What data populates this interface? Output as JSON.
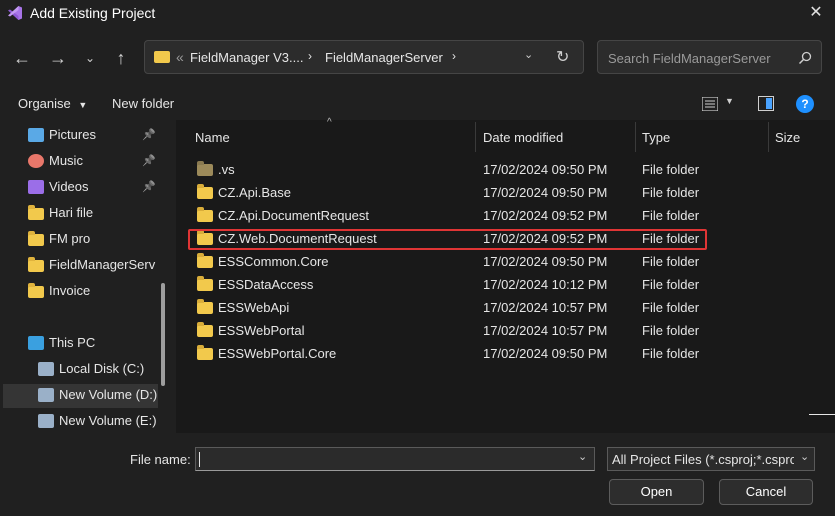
{
  "window": {
    "title": "Add Existing Project",
    "app_icon": "visual-studio-icon",
    "close_icon": "close-icon"
  },
  "nav": {
    "back_icon": "arrow-left-icon",
    "forward_icon": "arrow-right-icon",
    "recent_icon": "chevron-down-icon",
    "up_icon": "arrow-up-icon",
    "breadcrumb": [
      "FieldManager V3....",
      "FieldManagerServer"
    ],
    "breadcrumb_prefix": "«",
    "refresh_icon": "refresh-icon",
    "search_placeholder": "Search FieldManagerServer"
  },
  "toolbar": {
    "organise": "Organise",
    "new_folder": "New folder",
    "view_icon": "view-list-icon",
    "preview_icon": "preview-pane-icon",
    "help_icon": "help-icon"
  },
  "sidebar": {
    "items": [
      {
        "label": "Pictures",
        "icon": "pictures-icon",
        "pinned": true
      },
      {
        "label": "Music",
        "icon": "music-icon",
        "pinned": true
      },
      {
        "label": "Videos",
        "icon": "videos-icon",
        "pinned": true
      },
      {
        "label": "Hari file",
        "icon": "folder-icon",
        "pinned": false
      },
      {
        "label": "FM pro",
        "icon": "folder-icon",
        "pinned": false
      },
      {
        "label": "FieldManagerServ",
        "icon": "folder-icon",
        "pinned": false
      },
      {
        "label": "Invoice",
        "icon": "folder-icon",
        "pinned": false
      },
      {
        "label": "This PC",
        "icon": "computer-icon",
        "pinned": false
      },
      {
        "label": "Local Disk (C:)",
        "icon": "drive-icon",
        "pinned": false
      },
      {
        "label": "New Volume (D:)",
        "icon": "drive-icon",
        "pinned": false,
        "selected": true
      },
      {
        "label": "New Volume (E:)",
        "icon": "drive-icon",
        "pinned": false
      }
    ]
  },
  "columns": {
    "name": "Name",
    "date": "Date modified",
    "type": "Type",
    "size": "Size"
  },
  "files": [
    {
      "name": ".vs",
      "date": "17/02/2024 09:50 PM",
      "type": "File folder"
    },
    {
      "name": "CZ.Api.Base",
      "date": "17/02/2024 09:50 PM",
      "type": "File folder"
    },
    {
      "name": "CZ.Api.DocumentRequest",
      "date": "17/02/2024 09:52 PM",
      "type": "File folder"
    },
    {
      "name": "CZ.Web.DocumentRequest",
      "date": "17/02/2024 09:52 PM",
      "type": "File folder"
    },
    {
      "name": "ESSCommon.Core",
      "date": "17/02/2024 09:50 PM",
      "type": "File folder"
    },
    {
      "name": "ESSDataAccess",
      "date": "17/02/2024 10:12 PM",
      "type": "File folder"
    },
    {
      "name": "ESSWebApi",
      "date": "17/02/2024 10:57 PM",
      "type": "File folder"
    },
    {
      "name": "ESSWebPortal",
      "date": "17/02/2024 10:57 PM",
      "type": "File folder"
    },
    {
      "name": "ESSWebPortal.Core",
      "date": "17/02/2024 09:50 PM",
      "type": "File folder"
    }
  ],
  "bottom": {
    "file_name_label": "File name:",
    "file_name_value": "",
    "filter": "All Project Files (*.csproj;*.csproj",
    "open": "Open",
    "cancel": "Cancel"
  },
  "colors": {
    "highlight": "#e03535",
    "folder": "#f2c94c",
    "help": "#1e90ff"
  }
}
